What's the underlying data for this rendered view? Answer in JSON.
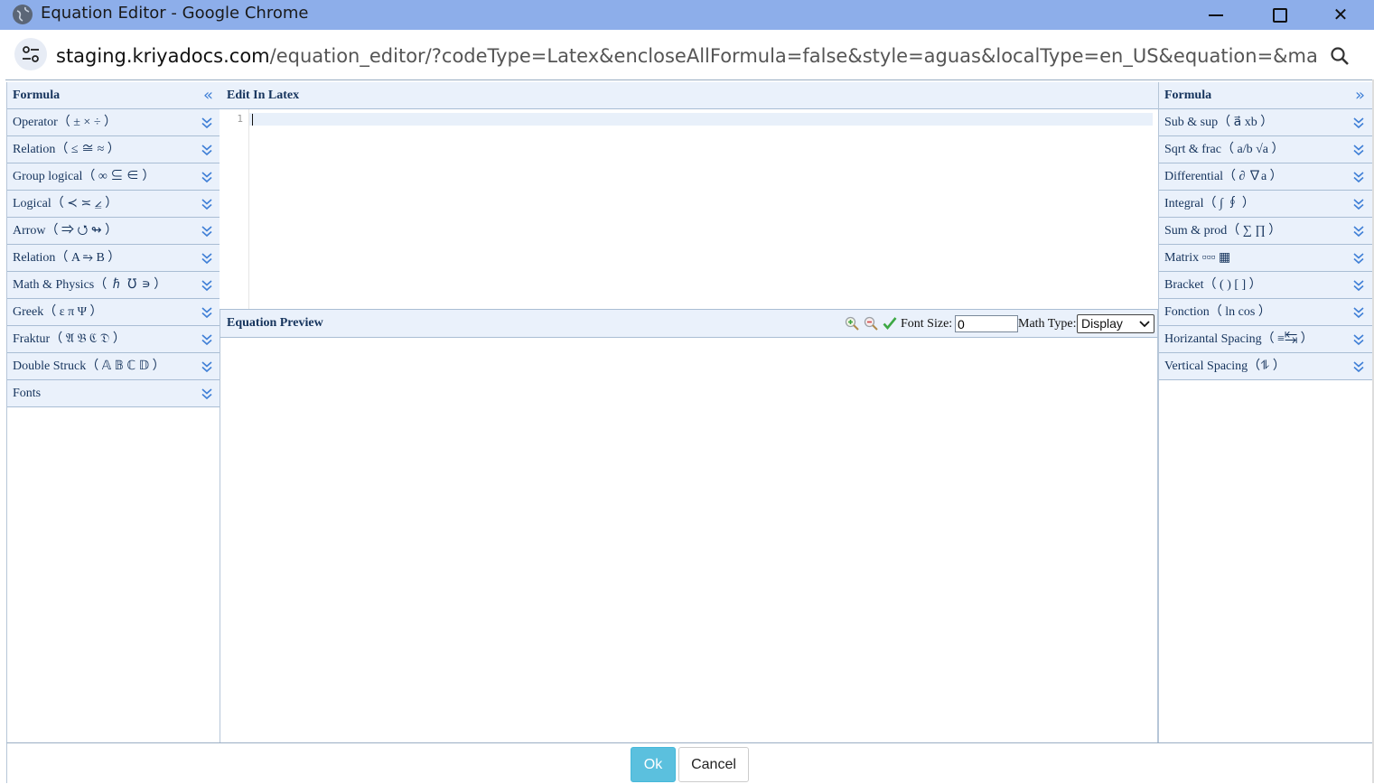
{
  "window": {
    "title": "Equation Editor - Google Chrome",
    "url_host": "staging.kriyadocs.com",
    "url_path": "/equation_editor/?codeType=Latex&encloseAllFormula=false&style=aguas&localType=en_US&equation=&mathType=new&c...",
    "minimize_label": "",
    "close_label": "✕"
  },
  "left_panel": {
    "title": "Formula",
    "collapse_glyph": "«",
    "items": [
      {
        "label": "Operator（ ±  ×  ÷ ）"
      },
      {
        "label": "Relation（ ≤  ≅  ≈ ）"
      },
      {
        "label": "Group logical（ ∞  ⊆  ∈ ）"
      },
      {
        "label": "Logical（ ≺  ≍  ⦤ ）"
      },
      {
        "label": "Arrow（ ⇒  ⭯  ↬ ）"
      },
      {
        "label": "Relation（ A ⥱ B ）"
      },
      {
        "label": "Math & Physics（ ℏ  ℧  ∍ ）"
      },
      {
        "label": "Greek（ ε  π  Ψ ）"
      },
      {
        "label": "Fraktur（ 𝔄 𝔅 ℭ 𝔇 ）"
      },
      {
        "label": "Double Struck（ 𝔸 𝔹 ℂ 𝔻 ）"
      },
      {
        "label": "Fonts"
      }
    ]
  },
  "editor": {
    "title": "Edit In Latex",
    "line_number": "1",
    "content": ""
  },
  "preview": {
    "title": "Equation Preview",
    "font_size_label": "Font Size:",
    "font_size_value": "0",
    "math_type_label": "Math Type:",
    "math_type_value": "Display"
  },
  "right_panel": {
    "title": "Formula",
    "collapse_glyph": "»",
    "items": [
      {
        "label": "Sub & sup（ a⃗  xb ）"
      },
      {
        "label": "Sqrt & frac（ a/b  √a ）"
      },
      {
        "label": "Differential（ ∂  ∇a ）"
      },
      {
        "label": "Integral（ ∫  ∮ ）"
      },
      {
        "label": "Sum & prod（ ∑  ∏ ）"
      },
      {
        "label": "Matrix  ▫▫▫  ▦"
      },
      {
        "label": "Bracket（ ( )  [ ] ）"
      },
      {
        "label": "Fonction（ ln   cos ）"
      },
      {
        "label": "Horizantal Spacing（ ≡↹ ）"
      },
      {
        "label": "Vertical Spacing（⥮   ）"
      }
    ]
  },
  "footer": {
    "ok_label": "Ok",
    "cancel_label": "Cancel"
  },
  "colors": {
    "titlebar": "#8daeea",
    "panel_header": "#eaf1fb",
    "ok_button": "#5bc0de",
    "accent_chevron": "#3f7fd6"
  }
}
